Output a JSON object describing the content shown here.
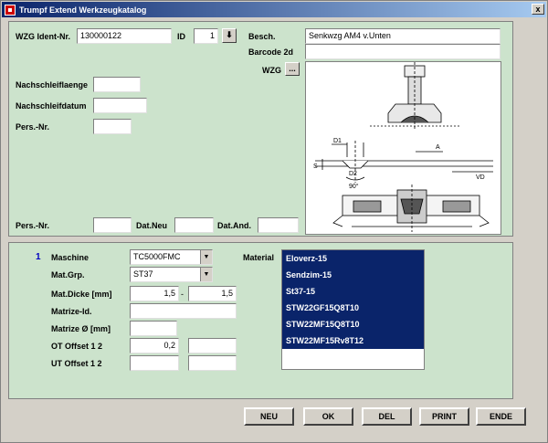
{
  "window": {
    "title": "Trumpf Extend Werkzeugkatalog",
    "close_glyph": "x"
  },
  "header": {
    "ident_label": "WZG Ident-Nr.",
    "ident_value": "130000122",
    "id_label": "ID",
    "id_value": "1",
    "id_button_glyph": "⬇",
    "besch_label": "Besch.",
    "besch_value": "Senkwzg AM4 v.Unten",
    "barcode_label": "Barcode 2d",
    "barcode_value": "",
    "wzg_label": "WZG",
    "wzg_button": "..."
  },
  "left_fields": {
    "nachschleiflaenge_label": "Nachschleiflaenge",
    "nachschleifdatum_label": "Nachschleifdatum",
    "pers_nr_label": "Pers.-Nr.",
    "pers_nr2_label": "Pers.-Nr.",
    "dat_neu_label": "Dat.Neu",
    "dat_and_label": "Dat.And."
  },
  "drawing": {
    "label_d1": "D1",
    "label_d2": "D2",
    "label_a": "A",
    "label_s": "S",
    "label_vd": "VD",
    "label_angle": "90°"
  },
  "record": {
    "number": "1",
    "maschine_label": "Maschine",
    "maschine_value": "TC5000FMC",
    "matgrp_label": "Mat.Grp.",
    "matgrp_value": "ST37",
    "matdicke_label": "Mat.Dicke [mm]",
    "matdicke_from": "1,5",
    "matdicke_sep": "-",
    "matdicke_to": "1,5",
    "matrize_id_label": "Matrize-Id.",
    "matrize_d_label": "Matrize Ø [mm]",
    "ot_offset_label": "OT Offset 1  2",
    "ot_offset_1": "0,2",
    "ut_offset_label": "UT Offset 1  2",
    "material_label": "Material",
    "materials": [
      "Eloverz-15",
      "Sendzim-15",
      "St37-15",
      "STW22GF15Q8T10",
      "STW22MF15Q8T10",
      "STW22MF15Rv8T12"
    ]
  },
  "buttons": {
    "neu": "NEU",
    "ok": "OK",
    "del": "DEL",
    "print": "PRINT",
    "ende": "ENDE"
  },
  "colors": {
    "panel": "#cce3cc",
    "selection": "#0a246a",
    "titlebar": "#0a246a"
  }
}
